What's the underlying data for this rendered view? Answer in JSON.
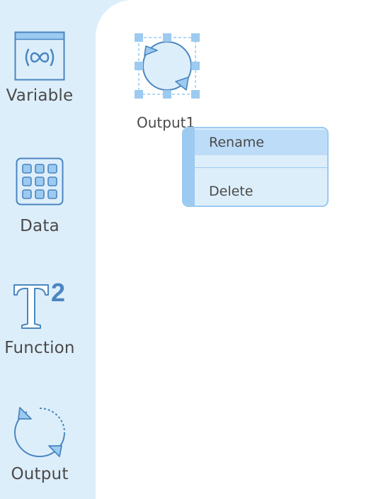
{
  "palette": {
    "items": [
      {
        "id": "variable",
        "label": "Variable",
        "icon": "variable-icon"
      },
      {
        "id": "data",
        "label": "Data",
        "icon": "grid-icon"
      },
      {
        "id": "function",
        "label": "Function",
        "icon": "function-icon"
      },
      {
        "id": "output",
        "label": "Output",
        "icon": "cycle-arrows-icon"
      }
    ]
  },
  "canvas": {
    "node": {
      "label": "Output1",
      "icon": "cycle-arrows-icon",
      "selected": true
    }
  },
  "context_menu": {
    "items": [
      {
        "label": "Rename",
        "highlighted": true
      },
      {
        "label": "Delete",
        "highlighted": false
      }
    ]
  },
  "colors": {
    "sidebar_bg": "#ddeefb",
    "accent": "#4a86c0",
    "selection_handle": "#9ccaf0",
    "menu_highlight": "#bcdcf8",
    "text": "#4a4a4a"
  }
}
